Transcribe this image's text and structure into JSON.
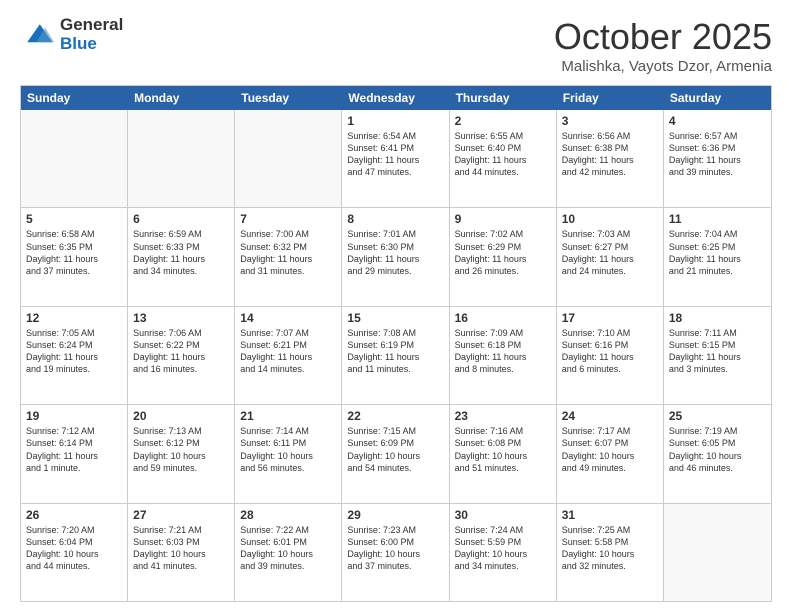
{
  "logo": {
    "general": "General",
    "blue": "Blue"
  },
  "header": {
    "month": "October 2025",
    "location": "Malishka, Vayots Dzor, Armenia"
  },
  "days": [
    "Sunday",
    "Monday",
    "Tuesday",
    "Wednesday",
    "Thursday",
    "Friday",
    "Saturday"
  ],
  "weeks": [
    [
      {
        "num": "",
        "content": ""
      },
      {
        "num": "",
        "content": ""
      },
      {
        "num": "",
        "content": ""
      },
      {
        "num": "1",
        "content": "Sunrise: 6:54 AM\nSunset: 6:41 PM\nDaylight: 11 hours\nand 47 minutes."
      },
      {
        "num": "2",
        "content": "Sunrise: 6:55 AM\nSunset: 6:40 PM\nDaylight: 11 hours\nand 44 minutes."
      },
      {
        "num": "3",
        "content": "Sunrise: 6:56 AM\nSunset: 6:38 PM\nDaylight: 11 hours\nand 42 minutes."
      },
      {
        "num": "4",
        "content": "Sunrise: 6:57 AM\nSunset: 6:36 PM\nDaylight: 11 hours\nand 39 minutes."
      }
    ],
    [
      {
        "num": "5",
        "content": "Sunrise: 6:58 AM\nSunset: 6:35 PM\nDaylight: 11 hours\nand 37 minutes."
      },
      {
        "num": "6",
        "content": "Sunrise: 6:59 AM\nSunset: 6:33 PM\nDaylight: 11 hours\nand 34 minutes."
      },
      {
        "num": "7",
        "content": "Sunrise: 7:00 AM\nSunset: 6:32 PM\nDaylight: 11 hours\nand 31 minutes."
      },
      {
        "num": "8",
        "content": "Sunrise: 7:01 AM\nSunset: 6:30 PM\nDaylight: 11 hours\nand 29 minutes."
      },
      {
        "num": "9",
        "content": "Sunrise: 7:02 AM\nSunset: 6:29 PM\nDaylight: 11 hours\nand 26 minutes."
      },
      {
        "num": "10",
        "content": "Sunrise: 7:03 AM\nSunset: 6:27 PM\nDaylight: 11 hours\nand 24 minutes."
      },
      {
        "num": "11",
        "content": "Sunrise: 7:04 AM\nSunset: 6:25 PM\nDaylight: 11 hours\nand 21 minutes."
      }
    ],
    [
      {
        "num": "12",
        "content": "Sunrise: 7:05 AM\nSunset: 6:24 PM\nDaylight: 11 hours\nand 19 minutes."
      },
      {
        "num": "13",
        "content": "Sunrise: 7:06 AM\nSunset: 6:22 PM\nDaylight: 11 hours\nand 16 minutes."
      },
      {
        "num": "14",
        "content": "Sunrise: 7:07 AM\nSunset: 6:21 PM\nDaylight: 11 hours\nand 14 minutes."
      },
      {
        "num": "15",
        "content": "Sunrise: 7:08 AM\nSunset: 6:19 PM\nDaylight: 11 hours\nand 11 minutes."
      },
      {
        "num": "16",
        "content": "Sunrise: 7:09 AM\nSunset: 6:18 PM\nDaylight: 11 hours\nand 8 minutes."
      },
      {
        "num": "17",
        "content": "Sunrise: 7:10 AM\nSunset: 6:16 PM\nDaylight: 11 hours\nand 6 minutes."
      },
      {
        "num": "18",
        "content": "Sunrise: 7:11 AM\nSunset: 6:15 PM\nDaylight: 11 hours\nand 3 minutes."
      }
    ],
    [
      {
        "num": "19",
        "content": "Sunrise: 7:12 AM\nSunset: 6:14 PM\nDaylight: 11 hours\nand 1 minute."
      },
      {
        "num": "20",
        "content": "Sunrise: 7:13 AM\nSunset: 6:12 PM\nDaylight: 10 hours\nand 59 minutes."
      },
      {
        "num": "21",
        "content": "Sunrise: 7:14 AM\nSunset: 6:11 PM\nDaylight: 10 hours\nand 56 minutes."
      },
      {
        "num": "22",
        "content": "Sunrise: 7:15 AM\nSunset: 6:09 PM\nDaylight: 10 hours\nand 54 minutes."
      },
      {
        "num": "23",
        "content": "Sunrise: 7:16 AM\nSunset: 6:08 PM\nDaylight: 10 hours\nand 51 minutes."
      },
      {
        "num": "24",
        "content": "Sunrise: 7:17 AM\nSunset: 6:07 PM\nDaylight: 10 hours\nand 49 minutes."
      },
      {
        "num": "25",
        "content": "Sunrise: 7:19 AM\nSunset: 6:05 PM\nDaylight: 10 hours\nand 46 minutes."
      }
    ],
    [
      {
        "num": "26",
        "content": "Sunrise: 7:20 AM\nSunset: 6:04 PM\nDaylight: 10 hours\nand 44 minutes."
      },
      {
        "num": "27",
        "content": "Sunrise: 7:21 AM\nSunset: 6:03 PM\nDaylight: 10 hours\nand 41 minutes."
      },
      {
        "num": "28",
        "content": "Sunrise: 7:22 AM\nSunset: 6:01 PM\nDaylight: 10 hours\nand 39 minutes."
      },
      {
        "num": "29",
        "content": "Sunrise: 7:23 AM\nSunset: 6:00 PM\nDaylight: 10 hours\nand 37 minutes."
      },
      {
        "num": "30",
        "content": "Sunrise: 7:24 AM\nSunset: 5:59 PM\nDaylight: 10 hours\nand 34 minutes."
      },
      {
        "num": "31",
        "content": "Sunrise: 7:25 AM\nSunset: 5:58 PM\nDaylight: 10 hours\nand 32 minutes."
      },
      {
        "num": "",
        "content": ""
      }
    ]
  ]
}
